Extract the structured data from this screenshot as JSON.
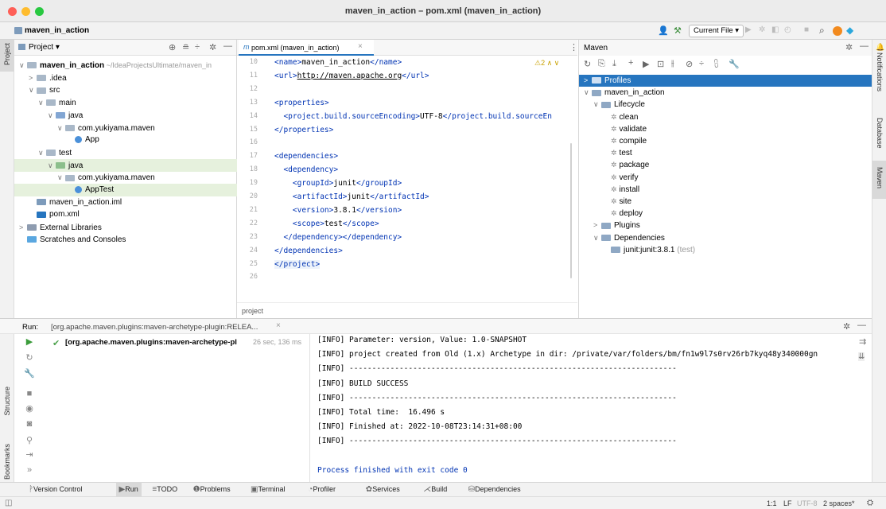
{
  "window": {
    "title": "maven_in_action – pom.xml (maven_in_action)"
  },
  "colors": {
    "accent": "#2675bf",
    "selection": "#e6f1dd",
    "selected_blue": "#2675bf",
    "tag_blue": "#0033b3",
    "comment_gray": "#8c8c8c"
  },
  "navbar": {
    "breadcrumb": "maven_in_action",
    "run_config": "Current File ▾"
  },
  "left_strip": {
    "project": "Project"
  },
  "project_panel": {
    "header": "Project ▾",
    "items": [
      {
        "label": "maven_in_action",
        "hint": "~/IdeaProjectsUltimate/maven_in",
        "indent": 0,
        "fold": "∨",
        "icon": "folder"
      },
      {
        "label": ".idea",
        "indent": 1,
        "fold": ">",
        "icon": "folder"
      },
      {
        "label": "src",
        "indent": 1,
        "fold": "∨",
        "icon": "folder"
      },
      {
        "label": "main",
        "indent": 2,
        "fold": "∨",
        "icon": "folder"
      },
      {
        "label": "java",
        "indent": 3,
        "fold": "∨",
        "icon": "folder-source"
      },
      {
        "label": "com.yukiyama.maven",
        "indent": 4,
        "fold": "∨",
        "icon": "package"
      },
      {
        "label": "App",
        "indent": 5,
        "fold": "",
        "icon": "class"
      },
      {
        "label": "test",
        "indent": 2,
        "fold": "∨",
        "icon": "folder"
      },
      {
        "label": "java",
        "indent": 3,
        "fold": "∨",
        "icon": "folder-test"
      },
      {
        "label": "com.yukiyama.maven",
        "indent": 4,
        "fold": "∨",
        "icon": "package"
      },
      {
        "label": "AppTest",
        "indent": 5,
        "fold": "",
        "icon": "class",
        "selected": true
      },
      {
        "label": "maven_in_action.iml",
        "indent": 1,
        "fold": "",
        "icon": "module"
      },
      {
        "label": "pom.xml",
        "indent": 1,
        "fold": "",
        "icon": "maven"
      },
      {
        "label": "External Libraries",
        "indent": 0,
        "fold": ">",
        "icon": "library"
      },
      {
        "label": "Scratches and Consoles",
        "indent": 0,
        "fold": "",
        "icon": "scratch"
      }
    ]
  },
  "editor": {
    "tab": "pom.xml (maven_in_action)",
    "inspection": "⚠2 ∧ ∨",
    "breadcrumb": "project",
    "lines": [
      {
        "n": "10",
        "text": "<name>maven_in_action</name>"
      },
      {
        "n": "11",
        "text": "<url>http://maven.apache.org</url>"
      },
      {
        "n": "12",
        "text": ""
      },
      {
        "n": "13",
        "text": "<properties>"
      },
      {
        "n": "14",
        "text": "  <project.build.sourceEncoding>UTF-8</project.build.sourceEn"
      },
      {
        "n": "15",
        "text": "</properties>"
      },
      {
        "n": "16",
        "text": ""
      },
      {
        "n": "17",
        "text": "<dependencies>"
      },
      {
        "n": "18",
        "text": "  <dependency>"
      },
      {
        "n": "19",
        "text": "    <groupId>junit</groupId>"
      },
      {
        "n": "20",
        "text": "    <artifactId>junit</artifactId>"
      },
      {
        "n": "21",
        "text": "    <version>3.8.1</version>"
      },
      {
        "n": "22",
        "text": "    <scope>test</scope>"
      },
      {
        "n": "23",
        "text": "  </dependency>"
      },
      {
        "n": "24",
        "text": "</dependencies>"
      },
      {
        "n": "25",
        "text": "</project>"
      },
      {
        "n": "26",
        "text": ""
      }
    ]
  },
  "maven_panel": {
    "title": "Maven",
    "items": [
      {
        "label": "Profiles",
        "indent": 0,
        "fold": ">",
        "selected": true
      },
      {
        "label": "maven_in_action",
        "indent": 0,
        "fold": "∨"
      },
      {
        "label": "Lifecycle",
        "indent": 1,
        "fold": "∨"
      },
      {
        "label": "clean",
        "indent": 2,
        "fold": ""
      },
      {
        "label": "validate",
        "indent": 2,
        "fold": ""
      },
      {
        "label": "compile",
        "indent": 2,
        "fold": ""
      },
      {
        "label": "test",
        "indent": 2,
        "fold": ""
      },
      {
        "label": "package",
        "indent": 2,
        "fold": ""
      },
      {
        "label": "verify",
        "indent": 2,
        "fold": ""
      },
      {
        "label": "install",
        "indent": 2,
        "fold": ""
      },
      {
        "label": "site",
        "indent": 2,
        "fold": ""
      },
      {
        "label": "deploy",
        "indent": 2,
        "fold": ""
      },
      {
        "label": "Plugins",
        "indent": 1,
        "fold": ">"
      },
      {
        "label": "Dependencies",
        "indent": 1,
        "fold": "∨"
      },
      {
        "label": "junit:junit:3.8.1",
        "suffix": "(test)",
        "indent": 2,
        "fold": ""
      }
    ]
  },
  "right_strip": {
    "notifications": "Notifications",
    "database": "Database",
    "maven": "Maven"
  },
  "run_panel": {
    "label": "Run:",
    "tab": "[org.apache.maven.plugins:maven-archetype-plugin:RELEA...",
    "tree_item": "[org.apache.maven.plugins:maven-archetype-pl",
    "tree_time": "26 sec, 136 ms",
    "output": [
      "[INFO] Parameter: version, Value: 1.0-SNAPSHOT",
      "[INFO] project created from Old (1.x) Archetype in dir: /private/var/folders/bm/fn1w9l7s0rv26rb7kyq48y340000gn",
      "[INFO] ------------------------------------------------------------------------",
      "[INFO] BUILD SUCCESS",
      "[INFO] ------------------------------------------------------------------------",
      "[INFO] Total time:  16.496 s",
      "[INFO] Finished at: 2022-10-08T23:14:31+08:00",
      "[INFO] ------------------------------------------------------------------------",
      "",
      "Process finished with exit code 0"
    ]
  },
  "bottom_side": {
    "structure": "Structure",
    "bookmarks": "Bookmarks"
  },
  "bottom_tabs": [
    {
      "label": "Version Control",
      "icon": "ᚹ"
    },
    {
      "label": "Run",
      "icon": "▶",
      "active": true
    },
    {
      "label": "TODO",
      "icon": "≡"
    },
    {
      "label": "Problems",
      "icon": "❶"
    },
    {
      "label": "Terminal",
      "icon": "▣"
    },
    {
      "label": "Profiler",
      "icon": "◔"
    },
    {
      "label": "Services",
      "icon": "✿"
    },
    {
      "label": "Build",
      "icon": "⋌"
    },
    {
      "label": "Dependencies",
      "icon": "⛁"
    }
  ],
  "status": {
    "position": "1:1",
    "line_sep": "LF",
    "encoding": "UTF-8",
    "indent": "2 spaces*"
  }
}
